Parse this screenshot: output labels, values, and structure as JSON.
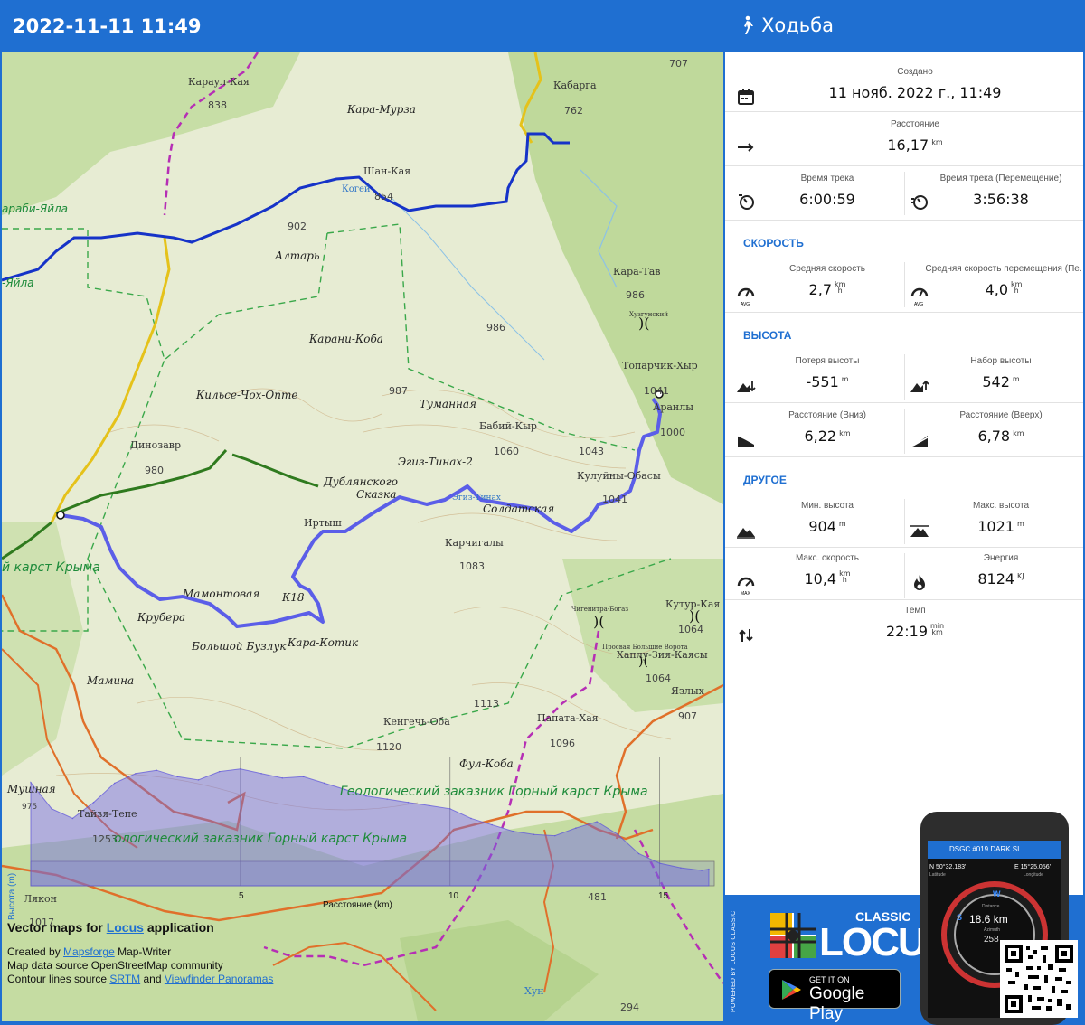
{
  "header": {
    "datetime": "2022-11-11 11:49",
    "activity": "Ходьба",
    "activity_icon": "walking-person-icon"
  },
  "map": {
    "labels": {
      "karaul_kaya": "Караул-Кая",
      "n838": "838",
      "kara_murza": "Кара-Мурза",
      "kabarga": "Кабарга",
      "n707": "707",
      "n762": "762",
      "shan_kaya": "Шан-Кая",
      "kogei": "Когей",
      "n854": "854",
      "karabi_yaila": "араби-Яйла",
      "n902": "902",
      "altar": "Алтарь",
      "yaila": "-Яйла",
      "kara_tav": "Кара-Тав",
      "n986a": "986",
      "n986b": "986",
      "khuzgunsky": "Хузгунский",
      "karani_koba": "Карани-Коба",
      "toparchik": "Топарчик-Хыр",
      "n1041a": "1041",
      "aranly": "Аранлы",
      "n1000": "1000",
      "kilse": "Кильсе-Чох-Опте",
      "n987": "987",
      "tumannaya": "Туманная",
      "babiy_kyr": "Бабий-Кыр",
      "dinozavr": "Динозавр",
      "n1060": "1060",
      "n1043": "1043",
      "egiz": "Эгиз-Тинах-2",
      "kuluyny": "Кулуйны-Обасы",
      "n980": "980",
      "dublyansky": "Дублянского",
      "skazka": "Сказка",
      "egiz_tinakh": "Эгиз-Тинах",
      "soldatskaya": "Солдатская",
      "n1041b": "1041",
      "irtysh": "Иртыш",
      "karchigaly": "Карчигалы",
      "karst_krym": "й карст Крыма",
      "n1083": "1083",
      "mamontovaya": "Мамонтовая",
      "k18": "К18",
      "chigenitra": "Чигенитра-Богаз",
      "kutur_kaya": "Кутур-Кая",
      "krubera": "Крубера",
      "bolshoy": "Большой Бузлук",
      "kara_kotik": "Кара-Котик",
      "n1064a": "1064",
      "prosvaya": "Просвая Большие Ворота",
      "khaplu": "Хаплу-Зия-Каясы",
      "n1064b": "1064",
      "mamina": "Мамина",
      "yazlykh": "Язлых",
      "n1113": "1113",
      "n907": "907",
      "papata": "Папата-Хая",
      "kengech": "Кенгечь-Оба",
      "n1096": "1096",
      "n1120": "1120",
      "ful_koba": "Фул-Коба",
      "mushnaya": "Мушная",
      "geo1": "Геологический заказник Горный карст Крыма",
      "tayzha": "Тайзя-Тепе",
      "n975": "975",
      "n1253": "1253",
      "geo2": "ологический заказник Горный карст Крыма",
      "lyakon": "Лякон",
      "n481": "481",
      "n1017": "1017",
      "khun": "Хун",
      "n294": "294"
    }
  },
  "elevation_chart": {
    "ylabel": "Высота (m)",
    "xlabel": "Расстояние (km)",
    "x_ticks": [
      "5",
      "10",
      "15"
    ]
  },
  "chart_data": {
    "type": "area",
    "xlabel": "Расстояние (km)",
    "ylabel": "Высота (m)",
    "x": [
      0,
      0.5,
      1,
      1.5,
      2,
      2.5,
      3,
      3.5,
      4,
      4.5,
      5,
      5.5,
      6,
      6.5,
      7,
      7.5,
      8,
      8.5,
      9,
      9.5,
      10,
      10.5,
      11,
      11.5,
      12,
      12.5,
      13,
      13.5,
      14,
      14.5,
      15,
      15.5,
      16,
      16.17
    ],
    "series": [
      {
        "values": [
          1041,
          1000,
          985,
          1010,
          1040,
          1055,
          1060,
          1050,
          1045,
          1058,
          1062,
          1055,
          1048,
          1050,
          1040,
          1030,
          1020,
          1015,
          1010,
          1005,
          1000,
          985,
          975,
          965,
          960,
          958,
          970,
          980,
          960,
          930,
          915,
          908,
          904,
          906
        ]
      }
    ]
  },
  "credits": {
    "title_prefix": "Vector maps for ",
    "title_link": "Locus",
    "title_suffix": " application",
    "line1_prefix": "Created by ",
    "line1_link": "Mapsforge",
    "line1_suffix": " Map-Writer",
    "line2": "Map data source OpenStreetMap community",
    "line3_prefix": "Contour lines source ",
    "line3_link1": "SRTM",
    "line3_mid": " and ",
    "line3_link2": "Viewfinder Panoramas"
  },
  "stats": {
    "created_label": "Создано",
    "created_value": "11 нояб. 2022 г., 11:49",
    "distance_label": "Расстояние",
    "distance_value": "16,17",
    "distance_unit": "km",
    "track_time_label": "Время трека",
    "track_time_value": "6:00:59",
    "moving_time_label": "Время трека (Перемещение)",
    "moving_time_value": "3:56:38",
    "speed_section": "СКОРОСТЬ",
    "avg_speed_label": "Средняя скорость",
    "avg_speed_value": "2,7",
    "avg_moving_speed_label": "Средняя скорость перемещения (Пе.",
    "avg_moving_speed_value": "4,0",
    "speed_unit_top": "km",
    "speed_unit_bottom": "h",
    "altitude_section": "ВЫСОТА",
    "elev_loss_label": "Потеря высоты",
    "elev_loss_value": "-551",
    "elev_gain_label": "Набор высоты",
    "elev_gain_value": "542",
    "m_unit": "m",
    "dist_down_label": "Расстояние (Вниз)",
    "dist_down_value": "6,22",
    "dist_up_label": "Расстояние (Вверх)",
    "dist_up_value": "6,78",
    "other_section": "ДРУГОЕ",
    "min_alt_label": "Мин. высота",
    "min_alt_value": "904",
    "max_alt_label": "Макс. высота",
    "max_alt_value": "1021",
    "max_speed_label": "Макс. скорость",
    "max_speed_value": "10,4",
    "energy_label": "Энергия",
    "energy_value": "8124",
    "energy_unit": "KJ",
    "pace_label": "Темп",
    "pace_value": "22:19",
    "pace_unit_top": "min",
    "pace_unit_bottom": "km",
    "avg_badge": "AVG",
    "avg_moving_badge": "AVG",
    "max_badge": "MAX"
  },
  "promo": {
    "powered_by": "POWERED BY LOCUS CLASSIC",
    "classic": "CLASSIC",
    "locus": "LOCUS",
    "get_it_on": "GET IT ON",
    "google_play": "Google Play",
    "phone_title": "DSGC #019 DARK SI...",
    "phone_lat": "N 50°32.183'",
    "phone_lon": "E 15°25.056'",
    "phone_lat_label": "Latitude",
    "phone_lon_label": "Longitude",
    "phone_distance_label": "Distance",
    "phone_distance": "18.6 km",
    "phone_azimuth_label": "Azimuth",
    "phone_azimuth": "258",
    "phone_dir_w": "W",
    "phone_dir_s": "S"
  },
  "colors": {
    "header_bg": "#1f6fd1",
    "accent": "#1f6fd1",
    "track": "#5b5ee8",
    "route_blue": "#1633c8"
  }
}
